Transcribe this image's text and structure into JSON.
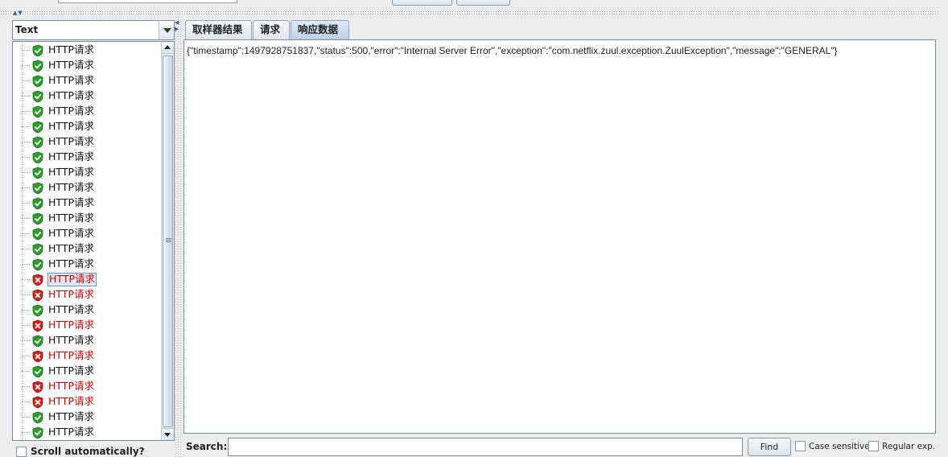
{
  "left_panel": {
    "renderer": "Text",
    "scroll_auto_label": "Scroll automatically?",
    "tree_items": [
      {
        "label": "HTTP请求",
        "status": "success"
      },
      {
        "label": "HTTP请求",
        "status": "success"
      },
      {
        "label": "HTTP请求",
        "status": "success"
      },
      {
        "label": "HTTP请求",
        "status": "success"
      },
      {
        "label": "HTTP请求",
        "status": "success"
      },
      {
        "label": "HTTP请求",
        "status": "success"
      },
      {
        "label": "HTTP请求",
        "status": "success"
      },
      {
        "label": "HTTP请求",
        "status": "success"
      },
      {
        "label": "HTTP请求",
        "status": "success"
      },
      {
        "label": "HTTP请求",
        "status": "success"
      },
      {
        "label": "HTTP请求",
        "status": "success"
      },
      {
        "label": "HTTP请求",
        "status": "success"
      },
      {
        "label": "HTTP请求",
        "status": "success"
      },
      {
        "label": "HTTP请求",
        "status": "success"
      },
      {
        "label": "HTTP请求",
        "status": "success"
      },
      {
        "label": "HTTP请求",
        "status": "failure",
        "selected": true
      },
      {
        "label": "HTTP请求",
        "status": "failure"
      },
      {
        "label": "HTTP请求",
        "status": "success"
      },
      {
        "label": "HTTP请求",
        "status": "failure"
      },
      {
        "label": "HTTP请求",
        "status": "success"
      },
      {
        "label": "HTTP请求",
        "status": "failure"
      },
      {
        "label": "HTTP请求",
        "status": "success"
      },
      {
        "label": "HTTP请求",
        "status": "failure"
      },
      {
        "label": "HTTP请求",
        "status": "failure"
      },
      {
        "label": "HTTP请求",
        "status": "success"
      },
      {
        "label": "HTTP请求",
        "status": "success"
      }
    ]
  },
  "tabs": [
    {
      "label": "取样器结果",
      "active": false
    },
    {
      "label": "请求",
      "active": false
    },
    {
      "label": "响应数据",
      "active": true
    }
  ],
  "response": {
    "text": "{\"timestamp\":1497928751837,\"status\":500,\"error\":\"Internal Server Error\",\"exception\":\"com.netflix.zuul.exception.ZuulException\",\"message\":\"GENERAL\"}"
  },
  "search": {
    "label": "Search:",
    "value": "",
    "find_label": "Find",
    "case_sensitive_label": "Case sensitive",
    "regex_label": "Regular exp."
  },
  "icons": {
    "success": "green-shield-check-icon",
    "failure": "red-shield-x-icon"
  },
  "colors": {
    "success": "#2e9b2e",
    "failure": "#cc2222",
    "failure_text": "#cc0000"
  }
}
